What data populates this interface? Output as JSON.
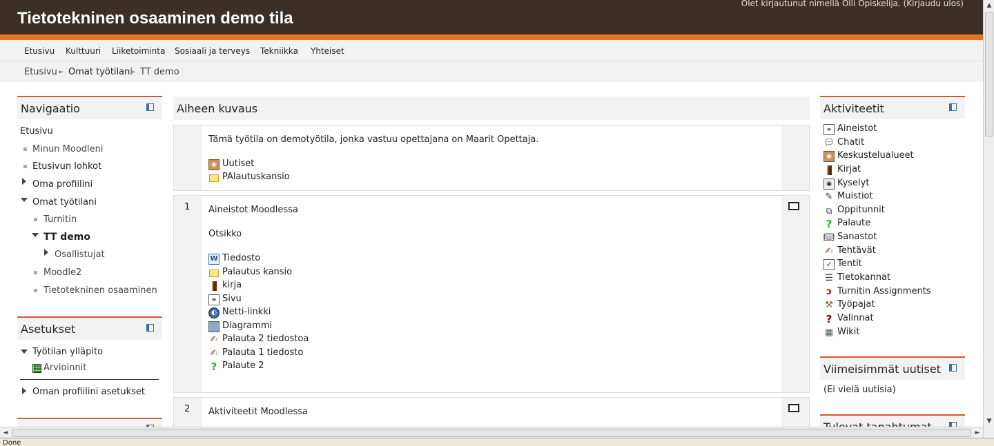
{
  "header": {
    "login_info": "Olet kirjautunut nimellä Olli Opiskelija. (Kirjaudu ulos)",
    "site_title": "Tietotekninen osaaminen demo tila",
    "accent_color": "#e8731e",
    "bg_color": "#3b2f27"
  },
  "custommenu": [
    "Etusivu",
    "Kulttuuri",
    "Liiketoiminta",
    "Sosiaali ja terveys",
    "Tekniikka",
    "Yhteiset"
  ],
  "breadcrumb": [
    "Etusivu",
    "Omat työtilani",
    "TT demo"
  ],
  "navigation": {
    "title": "Navigaatio",
    "items": [
      "Etusivu",
      "Minun Moodleni",
      "Etusivun lohkot",
      "Oma profiilini",
      "Omat työtilani",
      "Turnitin",
      "TT demo",
      "Osallistujat",
      "Moodle2",
      "Tietotekninen osaaminen"
    ]
  },
  "settings": {
    "title": "Asetukset",
    "items": [
      "Työtilan ylläpito",
      "Arvioinnit",
      "Oman profiilini asetukset"
    ]
  },
  "main": {
    "title": "Aiheen kuvaus",
    "intro": {
      "text": "Tämä työtila on demotyötila, jonka vastuu opettajana on Maarit Opettaja.",
      "links": [
        {
          "icon": "forum-icon",
          "label": "Uutiset"
        },
        {
          "icon": "folder-icon",
          "label": "PAlautuskansio"
        }
      ]
    },
    "section1": {
      "number": "1",
      "title": "Aineistot Moodlessa",
      "subtitle": "Otsikko",
      "links": [
        {
          "icon": "file-icon",
          "label": "Tiedosto"
        },
        {
          "icon": "folder-icon",
          "label": "Palautus kansio"
        },
        {
          "icon": "book-icon",
          "label": "kirja"
        },
        {
          "icon": "page-icon",
          "label": "Sivu"
        },
        {
          "icon": "url-icon",
          "label": "Netti-linkki"
        },
        {
          "icon": "image-icon",
          "label": "Diagrammi"
        },
        {
          "icon": "assignment-icon",
          "label": "Palauta 2 tiedostoa"
        },
        {
          "icon": "assignment-icon",
          "label": "Palauta 1 tiedosto"
        },
        {
          "icon": "feedback-icon",
          "label": "Palaute 2"
        }
      ]
    },
    "section2": {
      "number": "2",
      "title": "Aktiviteetit Moodlessa"
    }
  },
  "activities": {
    "title": "Aktiviteetit",
    "items": [
      {
        "icon": "resources-icon",
        "label": "Aineistot"
      },
      {
        "icon": "chat-icon",
        "label": "Chatit"
      },
      {
        "icon": "forum-icon",
        "label": "Keskustelualueet"
      },
      {
        "icon": "book-icon",
        "label": "Kirjat"
      },
      {
        "icon": "choice-icon",
        "label": "Kyselyt"
      },
      {
        "icon": "notes-icon",
        "label": "Muistiot"
      },
      {
        "icon": "lesson-icon",
        "label": "Oppitunnit"
      },
      {
        "icon": "feedback-icon",
        "label": "Palaute"
      },
      {
        "icon": "glossary-icon",
        "label": "Sanastot"
      },
      {
        "icon": "assignment-icon",
        "label": "Tehtävät"
      },
      {
        "icon": "quiz-icon",
        "label": "Tentit"
      },
      {
        "icon": "database-icon",
        "label": "Tietokannat"
      },
      {
        "icon": "turnitin-icon",
        "label": "Turnitin Assignments"
      },
      {
        "icon": "workshop-icon",
        "label": "Työpajat"
      },
      {
        "icon": "question-icon",
        "label": "Valinnat"
      },
      {
        "icon": "wiki-icon",
        "label": "Wikit"
      }
    ]
  },
  "news": {
    "title": "Viimeisimmät uutiset",
    "empty": "(Ei vielä uutisia)"
  },
  "upcoming": {
    "title": "Tulevat tapahtumat"
  },
  "status": {
    "text": "Done"
  }
}
